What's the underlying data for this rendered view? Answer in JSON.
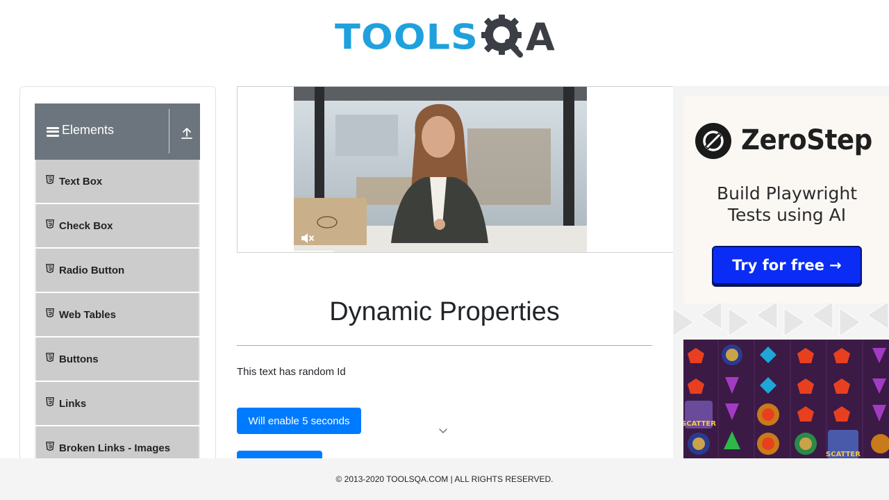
{
  "header": {
    "logo_word": "TOOLS",
    "logo_letter": "A"
  },
  "sidebar": {
    "group_title": "Elements",
    "items": [
      {
        "label": "Text Box"
      },
      {
        "label": "Check Box"
      },
      {
        "label": "Radio Button"
      },
      {
        "label": "Web Tables"
      },
      {
        "label": "Buttons"
      },
      {
        "label": "Links"
      },
      {
        "label": "Broken Links - Images"
      }
    ]
  },
  "main": {
    "title": "Dynamic Properties",
    "random_id_text": "This text has random Id",
    "enable_button_label": "Will enable 5 seconds"
  },
  "ad": {
    "brand": "ZeroStep",
    "tagline_line1": "Build Playwright",
    "tagline_line2": "Tests using AI",
    "cta": "Try for free →",
    "scatter_label": "SCATTER"
  },
  "footer": {
    "text": "© 2013-2020 TOOLSQA.COM | ALL RIGHTS RESERVED."
  },
  "colors": {
    "brand_blue": "#1fa1dd",
    "logo_dark": "#3b3f45",
    "group_header_bg": "#6c757d",
    "menu_item_bg": "#cccccc",
    "primary_button": "#007bff",
    "zerostep_cta": "#0a2cf5"
  },
  "icons": {
    "group": "hamburger-icon",
    "collapse": "upload-arrow-icon",
    "menu_item": "html5-icon",
    "mute": "muted-speaker-icon",
    "dropdown": "chevron-down-icon"
  }
}
